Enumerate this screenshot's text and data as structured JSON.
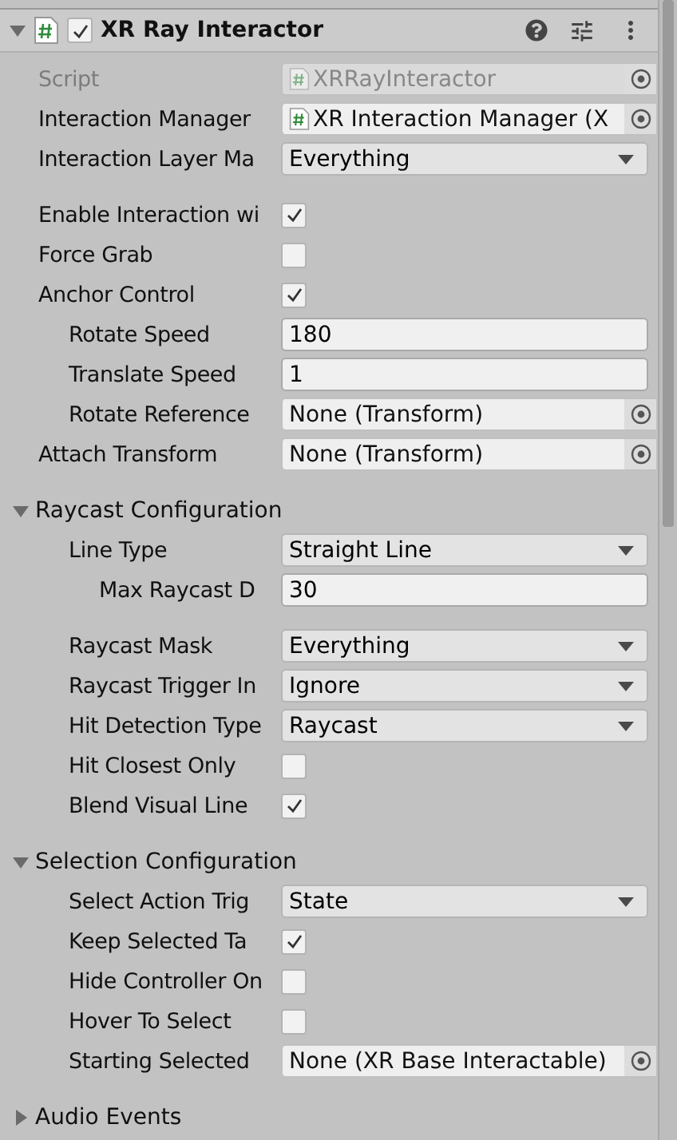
{
  "component": {
    "title": "XR Ray Interactor",
    "enabled": true,
    "expanded": true
  },
  "groups": [
    {
      "kind": "plain",
      "rows": [
        {
          "kind": "object",
          "label": "Script",
          "value": "XRRayInteractor",
          "disabled": true,
          "script_icon": true
        },
        {
          "kind": "object",
          "label": "Interaction Manager",
          "value": "XR Interaction Manager (X",
          "disabled": false,
          "script_icon": true
        },
        {
          "kind": "dropdown",
          "label": "Interaction Layer Ma",
          "value": "Everything"
        }
      ]
    },
    {
      "kind": "plain",
      "rows": [
        {
          "kind": "checkbox",
          "label": "Enable Interaction wi",
          "checked": true
        },
        {
          "kind": "checkbox",
          "label": "Force Grab",
          "checked": false
        },
        {
          "kind": "checkbox",
          "label": "Anchor Control",
          "checked": true,
          "children": [
            {
              "kind": "number",
              "label": "Rotate Speed",
              "value": "180"
            },
            {
              "kind": "number",
              "label": "Translate Speed",
              "value": "1"
            },
            {
              "kind": "object",
              "label": "Rotate Reference",
              "value": "None (Transform)",
              "disabled": false,
              "script_icon": false
            }
          ]
        },
        {
          "kind": "object",
          "label": "Attach Transform",
          "value": "None (Transform)",
          "disabled": false,
          "script_icon": false
        }
      ]
    },
    {
      "kind": "foldout",
      "title": "Raycast Configuration",
      "expanded": true,
      "rows": [
        {
          "kind": "dropdown",
          "label": "Line Type",
          "value": "Straight Line",
          "children": [
            {
              "kind": "number",
              "label": "Max Raycast D",
              "value": "30"
            }
          ]
        },
        {
          "kind": "dropdown",
          "label": "Raycast Mask",
          "value": "Everything",
          "spacer_before": true
        },
        {
          "kind": "dropdown",
          "label": "Raycast Trigger In",
          "value": "Ignore"
        },
        {
          "kind": "dropdown",
          "label": "Hit Detection Type",
          "value": "Raycast"
        },
        {
          "kind": "checkbox",
          "label": "Hit Closest Only",
          "checked": false
        },
        {
          "kind": "checkbox",
          "label": "Blend Visual Line",
          "checked": true
        }
      ]
    },
    {
      "kind": "foldout",
      "title": "Selection Configuration",
      "expanded": true,
      "rows": [
        {
          "kind": "dropdown",
          "label": "Select Action Trig",
          "value": "State"
        },
        {
          "kind": "checkbox",
          "label": "Keep Selected Ta",
          "checked": true
        },
        {
          "kind": "checkbox",
          "label": "Hide Controller On",
          "checked": false
        },
        {
          "kind": "checkbox",
          "label": "Hover To Select",
          "checked": false
        },
        {
          "kind": "object",
          "label": "Starting Selected",
          "value": "None (XR Base Interactable)",
          "disabled": false,
          "script_icon": false
        }
      ]
    },
    {
      "kind": "foldout",
      "title": "Audio Events",
      "expanded": false
    }
  ]
}
